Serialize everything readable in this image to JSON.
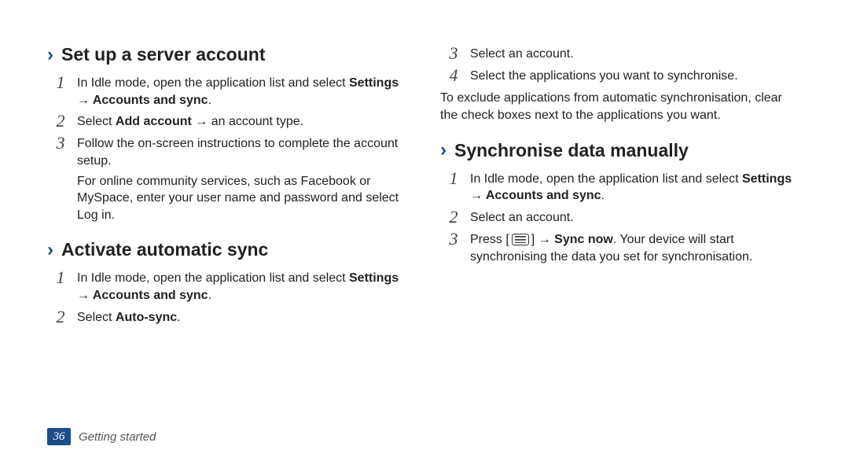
{
  "page": {
    "number": "36",
    "section": "Getting started"
  },
  "left": {
    "h1": "Set up a server account",
    "s1_pre": "In Idle mode, open the application list and select ",
    "s1_bold": "Settings → Accounts and sync",
    "s1_post": ".",
    "s2_a": "Select ",
    "s2_b": "Add account",
    "s2_c": " → an account type.",
    "s3": "Follow the on-screen instructions to complete the account setup.",
    "s3_note_a": "For online community services, such as Facebook or MySpace, enter your user name and password and select ",
    "s3_note_b": "Log in",
    "s3_note_c": ".",
    "h2": "Activate automatic sync",
    "a1_pre": "In Idle mode, open the application list and select ",
    "a1_bold": "Settings → Accounts and sync",
    "a1_post": ".",
    "a2_a": "Select ",
    "a2_b": "Auto-sync",
    "a2_c": "."
  },
  "right": {
    "c3": "Select an account.",
    "c4": "Select the applications you want to synchronise.",
    "note": "To exclude applications from automatic synchronisation, clear the check boxes next to the applications you want.",
    "h3": "Synchronise data manually",
    "m1_pre": "In Idle mode, open the application list and select ",
    "m1_bold": "Settings → Accounts and sync",
    "m1_post": ".",
    "m2": "Select an account.",
    "m3_a": "Press [",
    "m3_b": "] → ",
    "m3_c": "Sync now",
    "m3_d": ". Your device will start synchronising the data you set for synchronisation."
  }
}
